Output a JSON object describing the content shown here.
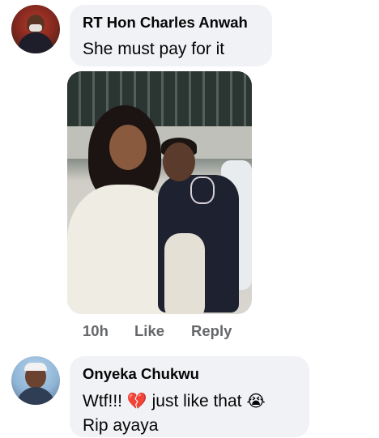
{
  "comments": [
    {
      "author": "RT Hon Charles Anwah",
      "text": "She must pay for it",
      "time": "10h",
      "like_label": "Like",
      "reply_label": "Reply"
    },
    {
      "author": "Onyeka Chukwu",
      "line1_prefix": "Wtf!!!",
      "line1_emoji1": "💔",
      "line1_middle": "just like that",
      "line1_emoji2": "😭",
      "line2": "Rip ayaya"
    }
  ],
  "colors": {
    "bubble": "#f0f2f5",
    "text": "#050505",
    "meta": "#65676b"
  }
}
